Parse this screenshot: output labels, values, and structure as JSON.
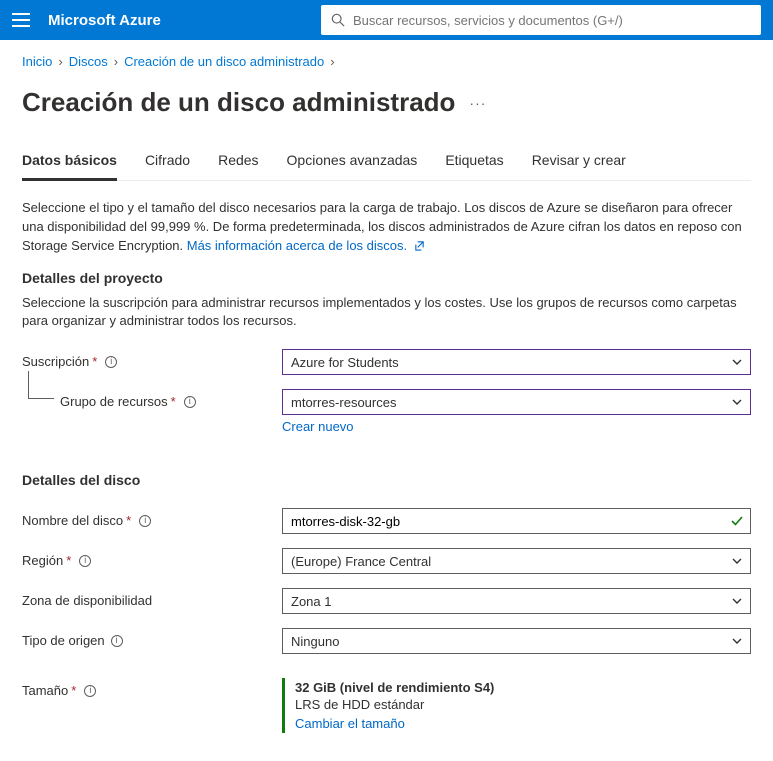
{
  "header": {
    "brand": "Microsoft Azure",
    "search_placeholder": "Buscar recursos, servicios y documentos (G+/)"
  },
  "breadcrumb": {
    "items": [
      "Inicio",
      "Discos",
      "Creación de un disco administrado"
    ]
  },
  "page": {
    "title": "Creación de un disco administrado"
  },
  "tabs": {
    "items": [
      {
        "label": "Datos básicos",
        "active": true
      },
      {
        "label": "Cifrado",
        "active": false
      },
      {
        "label": "Redes",
        "active": false
      },
      {
        "label": "Opciones avanzadas",
        "active": false
      },
      {
        "label": "Etiquetas",
        "active": false
      },
      {
        "label": "Revisar y crear",
        "active": false
      }
    ]
  },
  "intro": {
    "text": "Seleccione el tipo y el tamaño del disco necesarios para la carga de trabajo. Los discos de Azure se diseñaron para ofrecer una disponibilidad del 99,999 %. De forma predeterminada, los discos administrados de Azure cifran los datos en reposo con Storage Service Encryption. ",
    "link": "Más información acerca de los discos."
  },
  "sections": {
    "project": {
      "heading": "Detalles del proyecto",
      "desc": "Seleccione la suscripción para administrar recursos implementados y los costes. Use los grupos de recursos como carpetas para organizar y administrar todos los recursos.",
      "subscription_label": "Suscripción",
      "subscription_value": "Azure for Students",
      "rg_label": "Grupo de recursos",
      "rg_value": "mtorres-resources",
      "create_new": "Crear nuevo"
    },
    "disk": {
      "heading": "Detalles del disco",
      "name_label": "Nombre del disco",
      "name_value": "mtorres-disk-32-gb",
      "region_label": "Región",
      "region_value": "(Europe) France Central",
      "az_label": "Zona de disponibilidad",
      "az_value": "Zona 1",
      "source_label": "Tipo de origen",
      "source_value": "Ninguno",
      "size_label": "Tamaño",
      "size_main": "32 GiB (nivel de rendimiento S4)",
      "size_sub": "LRS de HDD estándar",
      "size_link": "Cambiar el tamaño"
    }
  }
}
